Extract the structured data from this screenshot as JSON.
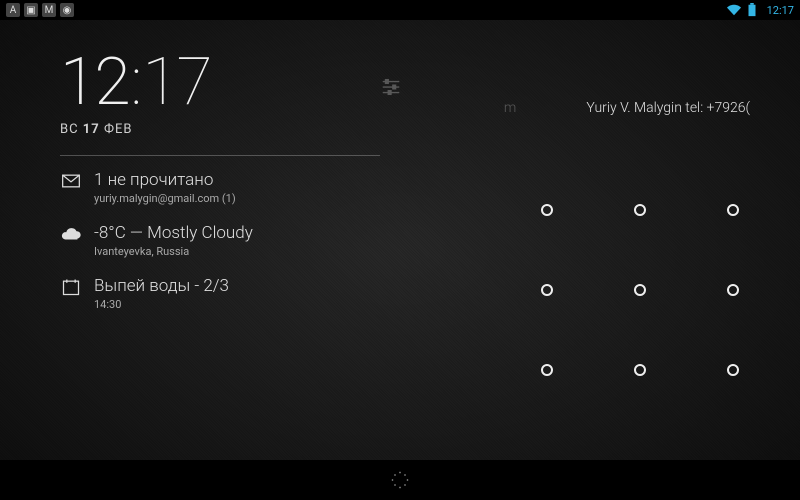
{
  "statusbar": {
    "clock": "12:17",
    "notif_icons": [
      "ABP",
      "gallery",
      "gmail",
      "sync"
    ]
  },
  "clock": {
    "hours": "12",
    "minutes": "17"
  },
  "date": {
    "dow": "ВС",
    "day": "17",
    "month": "ФЕВ"
  },
  "owner": {
    "hint_suffix": "m",
    "text": "Yuriy V. Malygin tel: +7926("
  },
  "extensions": [
    {
      "icon": "gmail-icon",
      "title": "1 не прочитано",
      "sub": "yuriy.malygin@gmail.com (1)"
    },
    {
      "icon": "cloud-icon",
      "title": "-8°C — Mostly Cloudy",
      "sub": "Ivanteyevka, Russia"
    },
    {
      "icon": "calendar-icon",
      "title": "Выпей воды - 2/3",
      "sub": "14:30"
    }
  ]
}
